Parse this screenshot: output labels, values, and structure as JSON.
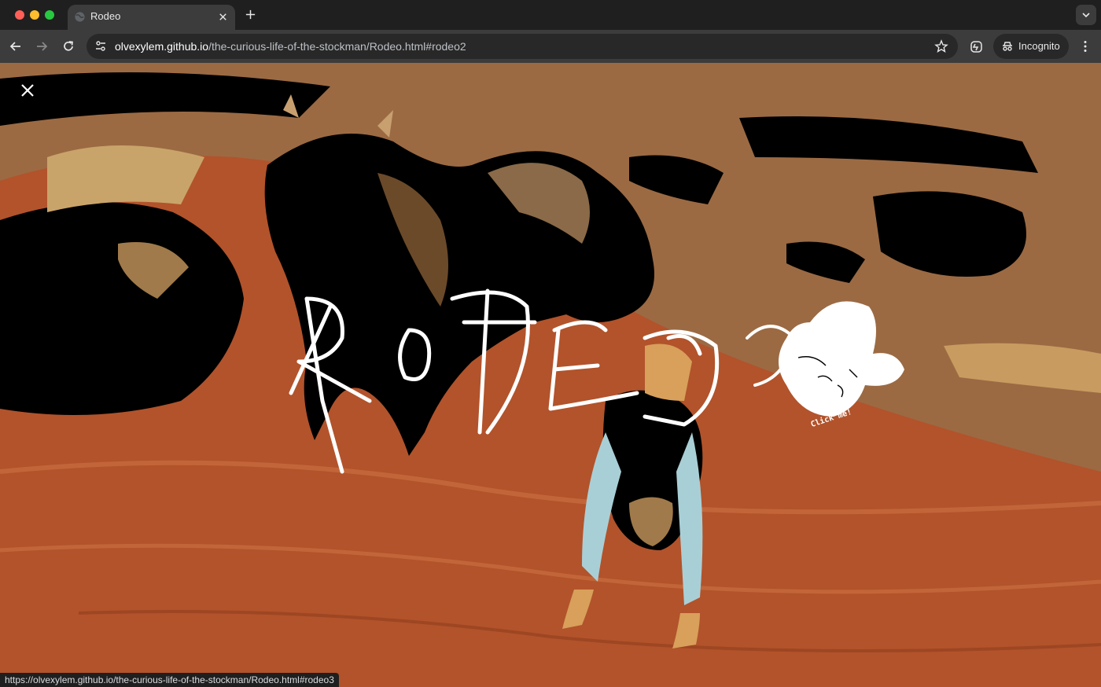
{
  "browser": {
    "tab_title": "Rodeo",
    "url_host": "olvexylem.github.io",
    "url_path": "/the-curious-life-of-the-stockman/Rodeo.html#rodeo2",
    "incognito_label": "Incognito",
    "status_url": "https://olvexylem.github.io/the-curious-life-of-the-stockman/Rodeo.html#rodeo3"
  },
  "page": {
    "click_hint": "Click me!",
    "colors": {
      "sand": "#b2532b",
      "dark": "#000000",
      "tan": "#a07a4a",
      "shirt": "#a9cfd6",
      "ink": "#ffffff"
    },
    "icons": [
      "close-icon",
      "cowboy-hat-icon"
    ]
  }
}
